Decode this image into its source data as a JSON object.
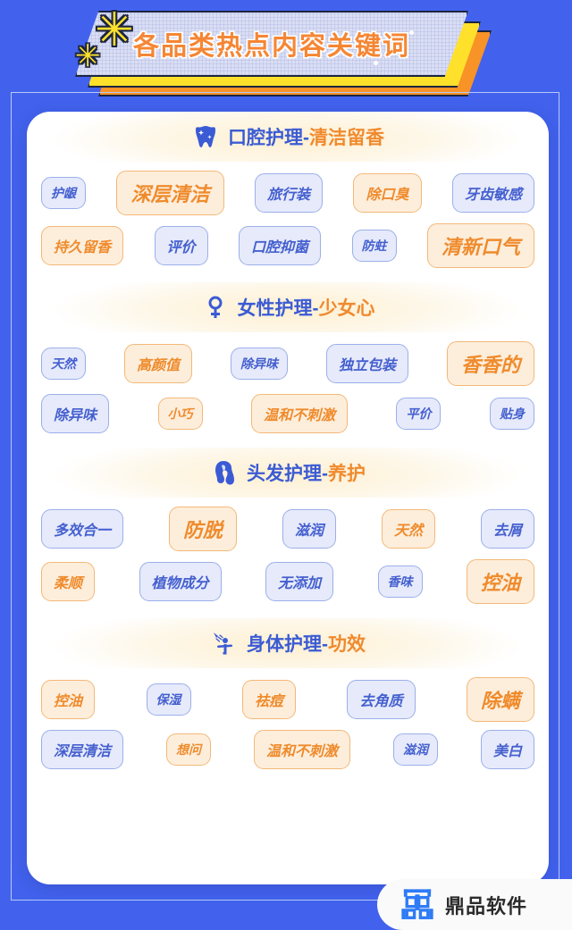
{
  "theme": {
    "bg_blue": "#4262EE",
    "accent_orange": "#F08A2E",
    "accent_blue": "#3B5BD4",
    "banner_yellow": "#FFE12B",
    "banner_orange": "#F79327"
  },
  "banner": {
    "title": "各品类热点内容关键词",
    "star_glyph": "✳",
    "star_small_glyph": "✳"
  },
  "sections": [
    {
      "icon": "tooth-icon",
      "title_blue": "口腔护理-",
      "title_orange": "清洁留香",
      "rows": [
        [
          {
            "label": "护龈",
            "color": "blue",
            "size": "s-s"
          },
          {
            "label": "深层清洁",
            "color": "orange",
            "size": "s-l"
          },
          {
            "label": "旅行装",
            "color": "blue",
            "size": "s-m"
          },
          {
            "label": "除口臭",
            "color": "orange",
            "size": "s-m"
          },
          {
            "label": "牙齿敏感",
            "color": "blue",
            "size": "s-m"
          }
        ],
        [
          {
            "label": "持久留香",
            "color": "orange",
            "size": "s-m"
          },
          {
            "label": "评价",
            "color": "blue",
            "size": "s-m"
          },
          {
            "label": "口腔抑菌",
            "color": "blue",
            "size": "s-m"
          },
          {
            "label": "防蛀",
            "color": "blue",
            "size": "s-s"
          },
          {
            "label": "清新口气",
            "color": "orange",
            "size": "s-l"
          }
        ]
      ]
    },
    {
      "icon": "venus-icon",
      "title_blue": "女性护理-",
      "title_orange": "少女心",
      "rows": [
        [
          {
            "label": "天然",
            "color": "blue",
            "size": "s-s"
          },
          {
            "label": "高颜值",
            "color": "orange",
            "size": "s-m"
          },
          {
            "label": "除异味",
            "color": "blue",
            "size": "s-s"
          },
          {
            "label": "独立包装",
            "color": "blue",
            "size": "s-m"
          },
          {
            "label": "香香的",
            "color": "orange",
            "size": "s-l"
          }
        ],
        [
          {
            "label": "除异味",
            "color": "blue",
            "size": "s-m"
          },
          {
            "label": "小巧",
            "color": "orange",
            "size": "s-s"
          },
          {
            "label": "温和不刺激",
            "color": "orange",
            "size": "s-m"
          },
          {
            "label": "平价",
            "color": "blue",
            "size": "s-s"
          },
          {
            "label": "贴身",
            "color": "blue",
            "size": "s-s"
          }
        ]
      ]
    },
    {
      "icon": "hair-icon",
      "title_blue": "头发护理-",
      "title_orange": "养护",
      "rows": [
        [
          {
            "label": "多效合一",
            "color": "blue",
            "size": "s-m"
          },
          {
            "label": "防脱",
            "color": "orange",
            "size": "s-l"
          },
          {
            "label": "滋润",
            "color": "blue",
            "size": "s-m"
          },
          {
            "label": "天然",
            "color": "orange",
            "size": "s-m"
          },
          {
            "label": "去屑",
            "color": "blue",
            "size": "s-m"
          }
        ],
        [
          {
            "label": "柔顺",
            "color": "orange",
            "size": "s-m"
          },
          {
            "label": "植物成分",
            "color": "blue",
            "size": "s-m"
          },
          {
            "label": "无添加",
            "color": "blue",
            "size": "s-m"
          },
          {
            "label": "香味",
            "color": "blue",
            "size": "s-s"
          },
          {
            "label": "控油",
            "color": "orange",
            "size": "s-l"
          }
        ]
      ]
    },
    {
      "icon": "shower-icon",
      "title_blue": "身体护理-",
      "title_orange": "功效",
      "rows": [
        [
          {
            "label": "控油",
            "color": "orange",
            "size": "s-m"
          },
          {
            "label": "保湿",
            "color": "blue",
            "size": "s-s"
          },
          {
            "label": "祛痘",
            "color": "orange",
            "size": "s-m"
          },
          {
            "label": "去角质",
            "color": "blue",
            "size": "s-m"
          },
          {
            "label": "除螨",
            "color": "orange",
            "size": "s-l"
          }
        ],
        [
          {
            "label": "深层清洁",
            "color": "blue",
            "size": "s-m"
          },
          {
            "label": "想问",
            "color": "orange",
            "size": "s-s"
          },
          {
            "label": "温和不刺激",
            "color": "orange",
            "size": "s-m"
          },
          {
            "label": "滋润",
            "color": "blue",
            "size": "s-s"
          },
          {
            "label": "美白",
            "color": "blue",
            "size": "s-m"
          }
        ]
      ]
    }
  ],
  "footer": {
    "logo_text": "鼎品软件",
    "logo_icon": "ding-logo-icon"
  }
}
